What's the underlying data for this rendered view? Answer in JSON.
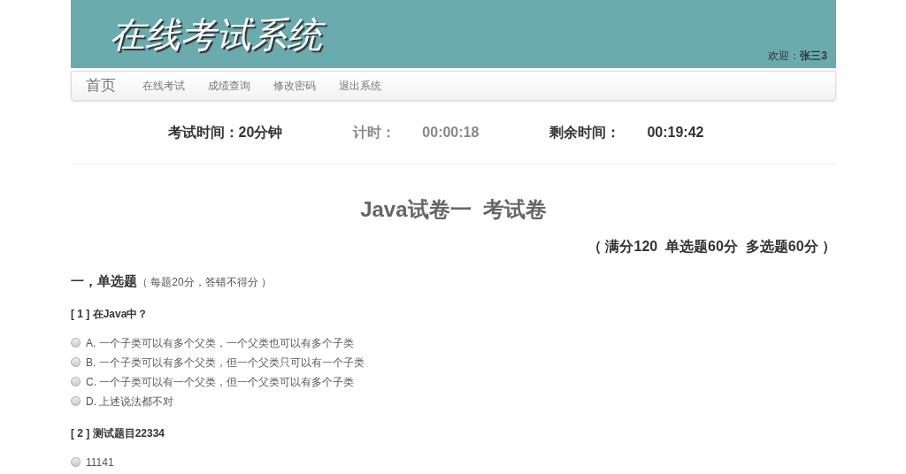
{
  "header": {
    "title": "在线考试系统",
    "welcome_label": "欢迎：",
    "user": "张三3"
  },
  "nav": {
    "brand": "首页",
    "items": [
      {
        "label": "在线考试"
      },
      {
        "label": "成绩查询"
      },
      {
        "label": "修改密码"
      },
      {
        "label": "退出系统"
      }
    ]
  },
  "timer": {
    "duration": "考试时间：20分钟",
    "elapsed_label": "计时：",
    "elapsed": "00:00:18",
    "remaining_label": "剩余时间：",
    "remaining": "00:19:42"
  },
  "paper": {
    "title": "Java试卷一  考试卷",
    "score": "（ 满分120  单选题60分  多选题60分 ）"
  },
  "sections": [
    {
      "heading": "一，单选题",
      "note": "（ 每题20分，答错不得分 ）",
      "questions": [
        {
          "title": "[ 1 ] 在Java中？",
          "options": [
            {
              "label": "A. 一个子类可以有多个父类，一个父类也可以有多个子类",
              "selected": false
            },
            {
              "label": "B. 一个子类可以有多个父类，但一个父类只可以有一个子类",
              "selected": false
            },
            {
              "label": "C. 一个子类可以有一个父类，但一个父类可以有多个子类",
              "selected": false
            },
            {
              "label": "D. 上述说法都不对",
              "selected": false
            }
          ]
        },
        {
          "title": "[ 2 ] 测试题目22334",
          "options": [
            {
              "label": "11141",
              "selected": false
            }
          ]
        }
      ]
    }
  ]
}
